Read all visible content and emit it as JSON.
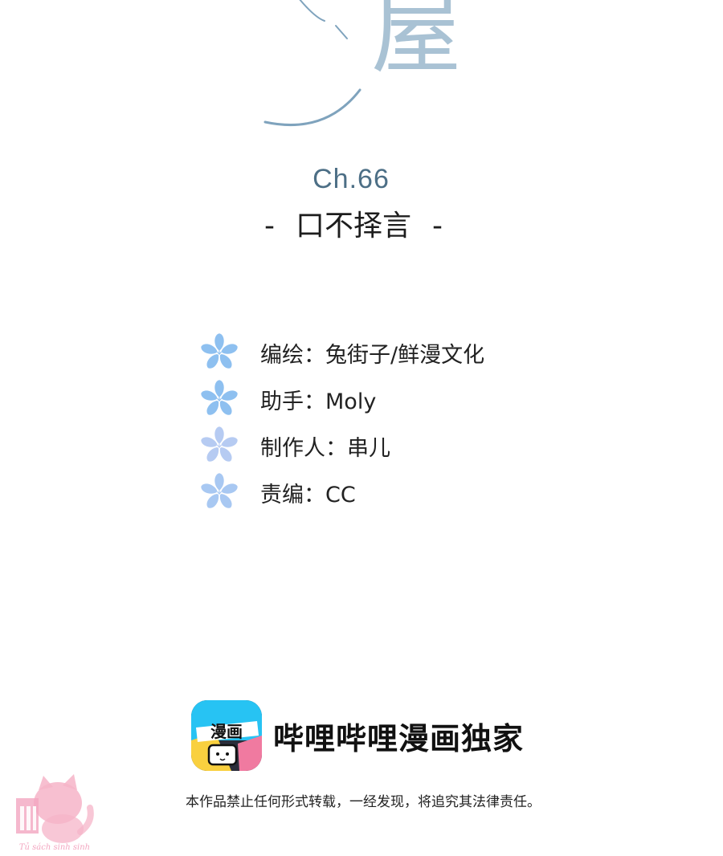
{
  "logo": {
    "glyph": "屋",
    "colors": {
      "stroke": "#8fb1c8",
      "text": "#a9c2d4"
    }
  },
  "chapter": {
    "number": "Ch.66",
    "title": "口不择言",
    "dash_left": "-",
    "dash_right": "-"
  },
  "credits": [
    {
      "icon": "flower-icon",
      "label": "编绘",
      "separator": "：",
      "value": "兔街子/鲜漫文化",
      "color": "#8ec0f0"
    },
    {
      "icon": "flower-icon",
      "label": "助手",
      "separator": "：",
      "value": "Moly",
      "color": "#8ec0f0"
    },
    {
      "icon": "flower-icon",
      "label": "制作人",
      "separator": "：",
      "value": "串儿",
      "color": "#b6cbf2"
    },
    {
      "icon": "flower-icon",
      "label": "责编",
      "separator": "：",
      "value": "CC",
      "color": "#a8c8f2"
    }
  ],
  "brand": {
    "icon": "bilibili-manga-app-icon",
    "icon_text": "漫画",
    "name": "哔哩哔哩漫画独家"
  },
  "disclaimer": "本作品禁止任何形式转载，一经发现，将追究其法律责任。",
  "watermark": {
    "icon": "pink-cat-logo",
    "text": "Tủ sách sinh sinh",
    "color": "#f3a6c0"
  }
}
